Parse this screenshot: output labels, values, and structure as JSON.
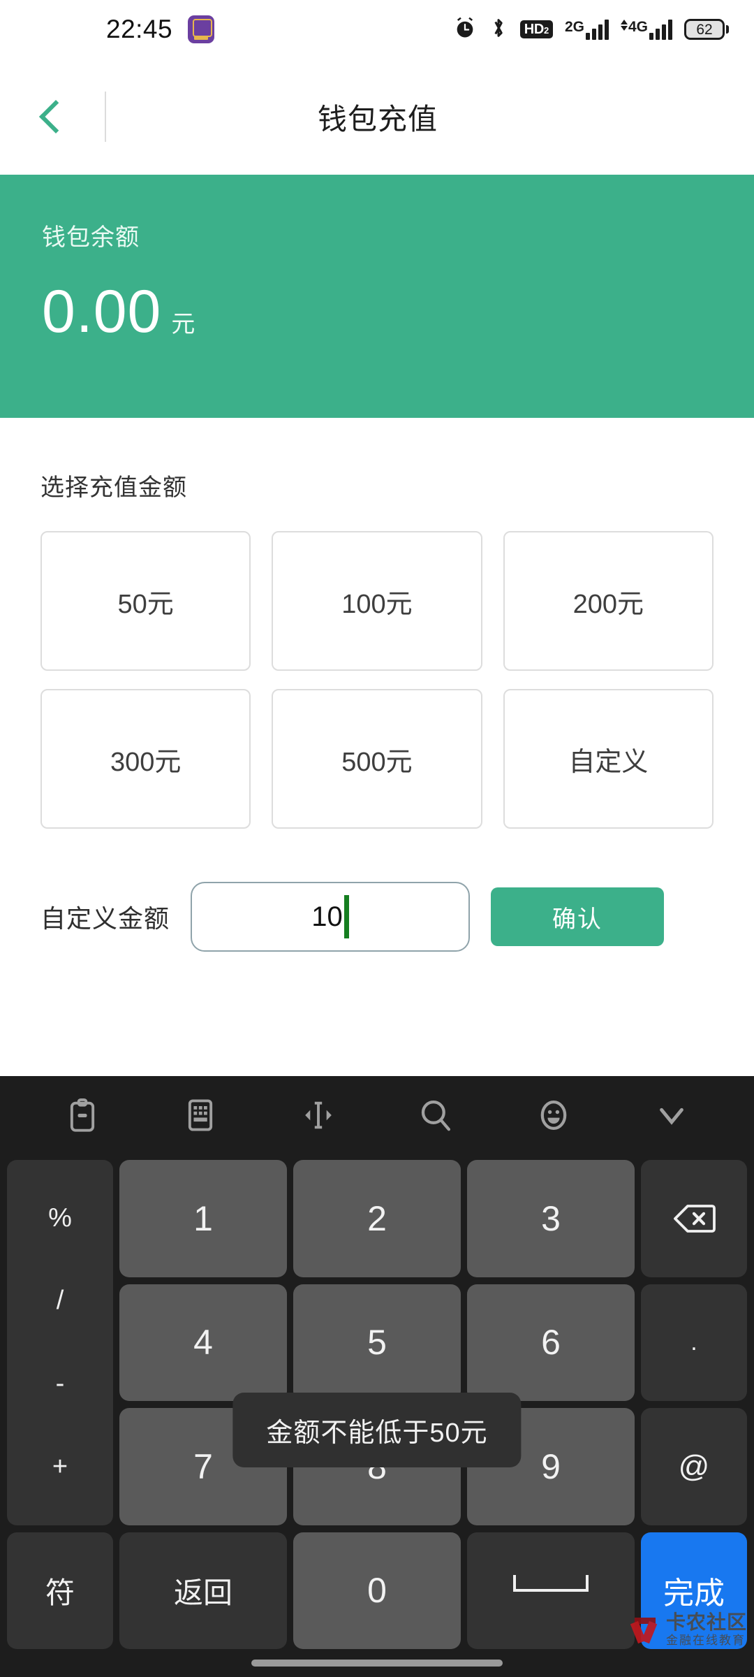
{
  "status_bar": {
    "time": "22:45",
    "app_icon": "app-badge-icon",
    "icons": [
      "alarm-icon",
      "bluetooth-icon",
      "hd2-icon",
      "signal-2g-icon",
      "signal-4g-icon",
      "battery-icon"
    ],
    "hd_label": "HD",
    "hd_sub": "2",
    "net_2g": "2G",
    "net_4g": "4G",
    "battery_level": "62"
  },
  "app_bar": {
    "back_icon": "chevron-left-icon",
    "title": "钱包充值"
  },
  "balance_card": {
    "label": "钱包余额",
    "amount": "0.00",
    "unit": "元",
    "color": "#3cb08a"
  },
  "recharge": {
    "section_title": "选择充值金额",
    "options": [
      {
        "label": "50元"
      },
      {
        "label": "100元"
      },
      {
        "label": "200元"
      },
      {
        "label": "300元"
      },
      {
        "label": "500元"
      },
      {
        "label": "自定义"
      }
    ],
    "custom_label": "自定义金额",
    "custom_value": "10",
    "custom_placeholder": "",
    "confirm_label": "确认",
    "confirm_color": "#3cb08a"
  },
  "toast": {
    "message": "金额不能低于50元"
  },
  "keyboard": {
    "toolbar": [
      "clipboard-icon",
      "keyboard-layout-icon",
      "cursor-move-icon",
      "search-icon",
      "emoji-icon",
      "collapse-chevron-down-icon"
    ],
    "left_column": [
      "%",
      "/",
      "-",
      "+"
    ],
    "keys": {
      "k1": "1",
      "k2": "2",
      "k3": "3",
      "k4": "4",
      "k5": "5",
      "k6": "6",
      "k7": "7",
      "k8": "8",
      "k9": "9",
      "k0": "0",
      "backspace": "backspace-icon",
      "dot": ".",
      "at": "@",
      "symbol": "符",
      "return": "返回",
      "space": "space-icon",
      "done": "完成"
    },
    "done_color": "#1878f0"
  },
  "watermark": {
    "title": "卡农社区",
    "subtitle": "金融在线教育"
  }
}
